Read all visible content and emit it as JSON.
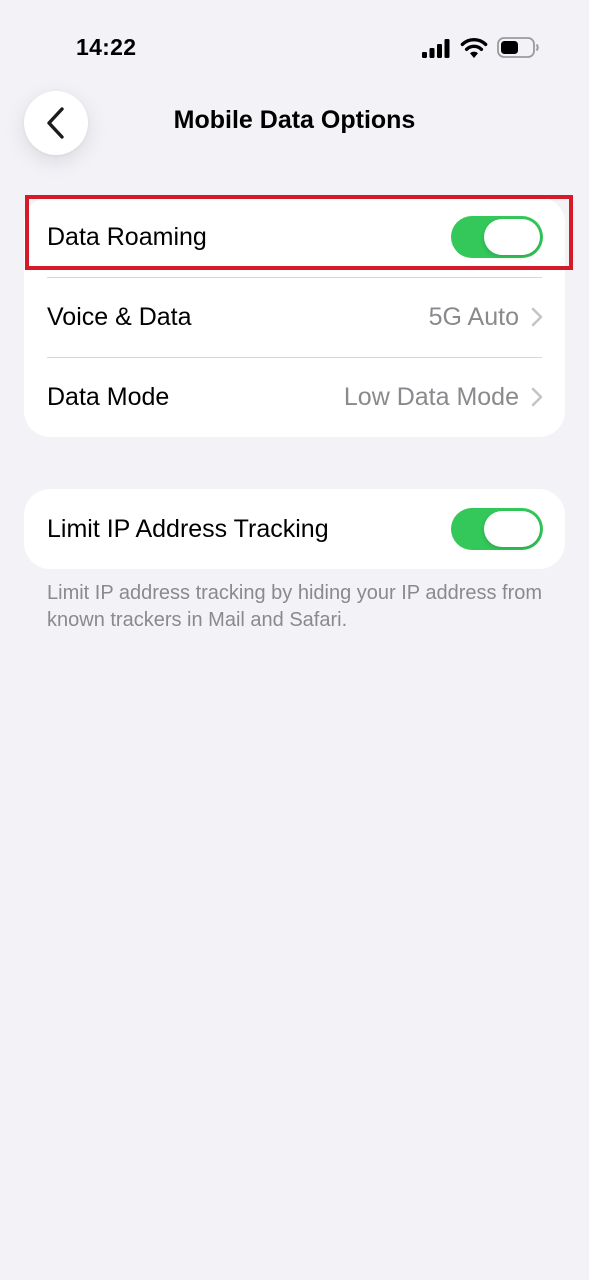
{
  "status_bar": {
    "time": "14:22",
    "icons": [
      "signal-icon",
      "wifi-icon",
      "battery-icon"
    ]
  },
  "nav": {
    "back_icon": "chevron-left-icon",
    "title": "Mobile Data Options"
  },
  "group1": {
    "data_roaming": {
      "label": "Data Roaming",
      "toggle_on": true
    },
    "voice_data": {
      "label": "Voice & Data",
      "value": "5G Auto"
    },
    "data_mode": {
      "label": "Data Mode",
      "value": "Low Data Mode"
    }
  },
  "group2": {
    "limit_ip": {
      "label": "Limit IP Address Tracking",
      "toggle_on": true
    },
    "footer": "Limit IP address tracking by hiding your IP address from known trackers in Mail and Safari."
  },
  "colors": {
    "background": "#f2f2f7",
    "toggle_on": "#34c759",
    "highlight": "#d51b2a",
    "secondary_text": "#8a8a8e"
  }
}
